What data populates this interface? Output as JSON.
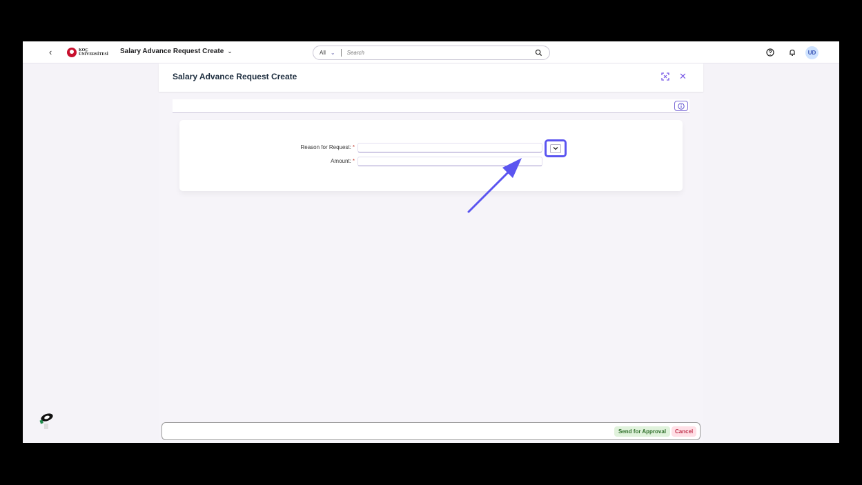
{
  "shellbar": {
    "logo_text_line1": "KOÇ",
    "logo_text_line2": "ÜNİVERSİTESİ",
    "app_title": "Salary Advance Request Create",
    "search_scope": "All",
    "search_placeholder": "Search",
    "avatar_initials": "UD"
  },
  "dialog": {
    "title": "Salary Advance Request Create",
    "fields": {
      "reason_label": "Reason for Request:",
      "reason_value": "",
      "amount_label": "Amount:",
      "amount_value": "",
      "required_mark": "*"
    }
  },
  "footer": {
    "send_label": "Send for Approval",
    "cancel_label": "Cancel"
  },
  "colors": {
    "accent": "#5b55f0",
    "required": "#c0392b",
    "send_bg": "#e0f2dc",
    "cancel_bg": "#ffdfe6"
  },
  "icons": [
    "back-chevron-icon",
    "logo-icon",
    "chevron-down-icon",
    "search-icon",
    "help-icon",
    "bell-icon",
    "expand-icon",
    "close-icon",
    "info-icon",
    "dropdown-chevron-icon",
    "robot-icon"
  ]
}
